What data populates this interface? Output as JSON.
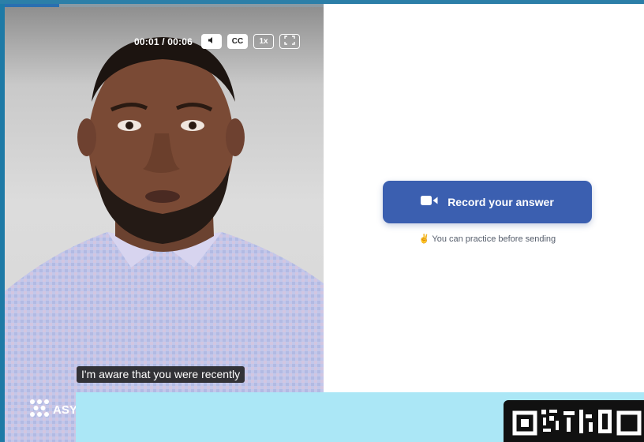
{
  "video": {
    "time": "00:01 / 00:06",
    "progress_fraction": 0.17,
    "controls": {
      "mute_icon": "speaker-icon",
      "cc_label": "CC",
      "speed_label": "1x",
      "fullscreen_icon": "fullscreen-icon"
    },
    "caption": "I'm aware that you were recently",
    "logo_text": "ASY"
  },
  "record": {
    "button_label": "Record your answer",
    "icon": "video-camera-icon",
    "hint_emoji": "✌",
    "hint_text": "You can practice before sending"
  },
  "colors": {
    "accent": "#3b5fb0",
    "banner": "#abe7f6",
    "frame": "#1e7aa6"
  }
}
